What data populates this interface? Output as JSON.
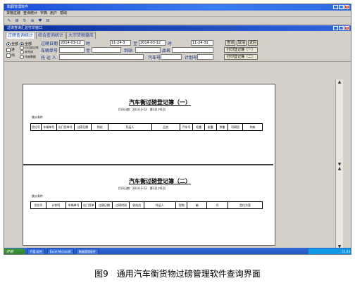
{
  "window": {
    "title": "衡器管理软件",
    "minimize": "_",
    "maximize": "□",
    "close": "×"
  },
  "menu": [
    "货物过磅",
    "查询统计",
    "字典",
    "用户",
    "帮助"
  ],
  "toolbar": [
    "✎",
    "⊞",
    "↻",
    "⊕",
    "♥",
    "⊟"
  ],
  "subwindow": {
    "title": "过磅查询汇总打印窗口"
  },
  "tabs": [
    "过磅查询统计",
    "综合查询统计",
    "大宗货物盘库"
  ],
  "filters": {
    "radio1": [
      "全部",
      "进",
      "出"
    ],
    "radio2": [
      "全部",
      "已过皮过毛",
      "未完成",
      "作废数据"
    ],
    "weigh_date_label": "过磅日期",
    "date_from": "2014-03-12",
    "time_label_1": "时",
    "time_from": "11-24-3",
    "to_label": "至",
    "date_to": "2014-03-12",
    "time_label_2": "时",
    "time_to": "11-24-31",
    "plate_label": "车辆单号",
    "plate_to_label": "至",
    "destination_label": "到站",
    "product_label": "品名",
    "consignor_label": "托 运 人",
    "truck_label": "汽车号",
    "planno_label": "计划号"
  },
  "buttons": {
    "query": "查询",
    "cancel": "取消",
    "back": "返回",
    "print1": "打印登记簿（一）",
    "print2": "打印登记簿（二）"
  },
  "report1": {
    "title": "汽车衡过磅登记簿（一）",
    "subtitle": "打印日期：2014-3-12　第1页 共1页",
    "condition": "统计条件",
    "columns": [
      "货位号",
      "车辆单号",
      "出门凭单号",
      "过磅日期",
      "到站",
      "托运人",
      "品名",
      "汽车号",
      "毛重",
      "皮重",
      "净重",
      "司磅员",
      "作废"
    ]
  },
  "report2": {
    "title": "汽车衡过磅登记簿（二）",
    "subtitle": "打印日期：2014-3-12　第1页 共1页",
    "condition": "统计条件：",
    "columns": [
      "货位号",
      "计划号",
      "车辆单号",
      "出门凭单",
      "过磅日期",
      "过磅时间",
      "发站员",
      "托运人",
      "货物",
      "箱",
      "号",
      "货位方案"
    ]
  },
  "taskbar": {
    "start": "开始",
    "tasks": [
      "FI盘·软件",
      "Excel·Microsoft",
      "衡器管理软件"
    ],
    "tray": "11:24"
  },
  "caption": "图9　通用汽车衡货物过磅管理软件查询界面"
}
